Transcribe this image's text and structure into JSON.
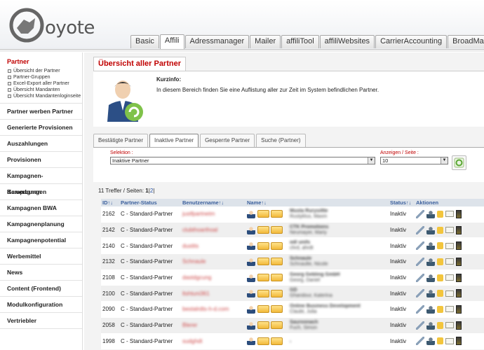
{
  "logo": {
    "text": "oyote"
  },
  "tabs": [
    "Basic",
    "Affili",
    "Adressmanager",
    "Mailer",
    "affiliTool",
    "affiliWebsites",
    "CarrierAccounting",
    "BroadMailCon"
  ],
  "active_tab": "Affili",
  "sidebar": {
    "section_title": "Partner",
    "sub_items": [
      "Übersicht der Partner",
      "Partner-Gruppen",
      "Excel-Export aller Partner",
      "Übersicht Mandanten",
      "Übersicht Mandantenloginseite"
    ],
    "items": [
      "Partner werben Partner",
      "Generierte Provisionen",
      "Auszahlungen",
      "Provisionen",
      "Kampagnen-Bewerbungen",
      "Kampagnen",
      "Kampagnen BWA",
      "Kampagnenplanung",
      "Kampagnenpotential",
      "Werbemittel",
      "News",
      "Content (Frontend)",
      "Modulkonfiguration",
      "Vertriebler"
    ]
  },
  "page": {
    "title": "Übersicht aller Partner",
    "info_title": "Kurzinfo:",
    "info_text": "In diesem Bereich finden Sie eine Auflistung aller zur Zeit im System befindlichen Partner."
  },
  "subtabs": [
    "Bestätigte Partner",
    "Inaktive Partner",
    "Gesperrte Partner",
    "Suche (Partner)"
  ],
  "active_subtab": "Inaktive Partner",
  "filter": {
    "selection_label": "Selektion :",
    "selection_value": "Inaktive Partner",
    "perpage_label": "Anzeigen / Seite :",
    "perpage_value": "10"
  },
  "hits": {
    "prefix": "11 Treffer / Seiten: ",
    "page1": "1",
    "sep1": "|",
    "page2": "2",
    "sep2": "|"
  },
  "table": {
    "headers": {
      "id": "ID↑↓",
      "status_partner": "Partner-Status",
      "username": "Benutzername↑↓",
      "name": "Name↑↓",
      "status": "Status↑↓",
      "actions": "Aktionen"
    },
    "rows": [
      {
        "id": "2162",
        "partner_status": "C - Standard-Partner",
        "username": "justfpartnetm",
        "name1": "Musta Rurysiltte",
        "name2": "Rustyklus, Maxm",
        "status": "Inaktiv"
      },
      {
        "id": "2142",
        "partner_status": "C - Standard-Partner",
        "username": "clubthoarthoal",
        "name1": "CTK Promotions",
        "name2": "Neumayer, Mariy",
        "status": "Inaktiv"
      },
      {
        "id": "2140",
        "partner_status": "C - Standard-Partner",
        "username": "dustits",
        "name1": "odl unifs",
        "name2": "chrd, ahrdt",
        "status": "Inaktiv"
      },
      {
        "id": "2132",
        "partner_status": "C - Standard-Partner",
        "username": "Schnaule",
        "name1": "Schnaule",
        "name2": "Schnaulte, Nicole",
        "status": "Inaktiv"
      },
      {
        "id": "2108",
        "partner_status": "C - Standard-Partner",
        "username": "dastdgcung",
        "name1": "Georg Gebling GmbH",
        "name2": "Georg, Daniel",
        "status": "Inaktiv"
      },
      {
        "id": "2100",
        "partner_status": "C - Standard-Partner",
        "username": "ltshtuni361",
        "name1": "GD",
        "name2": "Ghandour, Katerina",
        "status": "Inaktiv"
      },
      {
        "id": "2090",
        "partner_status": "C - Standard-Partner",
        "username": "bestalrdts-h-d.com",
        "name1": "Online Business Development",
        "name2": "Claubt, Julia",
        "status": "Inaktiv"
      },
      {
        "id": "2058",
        "partner_status": "C - Standard-Partner",
        "username": "Blerer",
        "name1": "Sauroonach",
        "name2": "Fuch, Simon",
        "status": "Inaktiv"
      },
      {
        "id": "1998",
        "partner_status": "C - Standard-Partner",
        "username": "sudghdt",
        "name1": ",",
        "name2": "",
        "status": "Inaktiv"
      }
    ]
  }
}
